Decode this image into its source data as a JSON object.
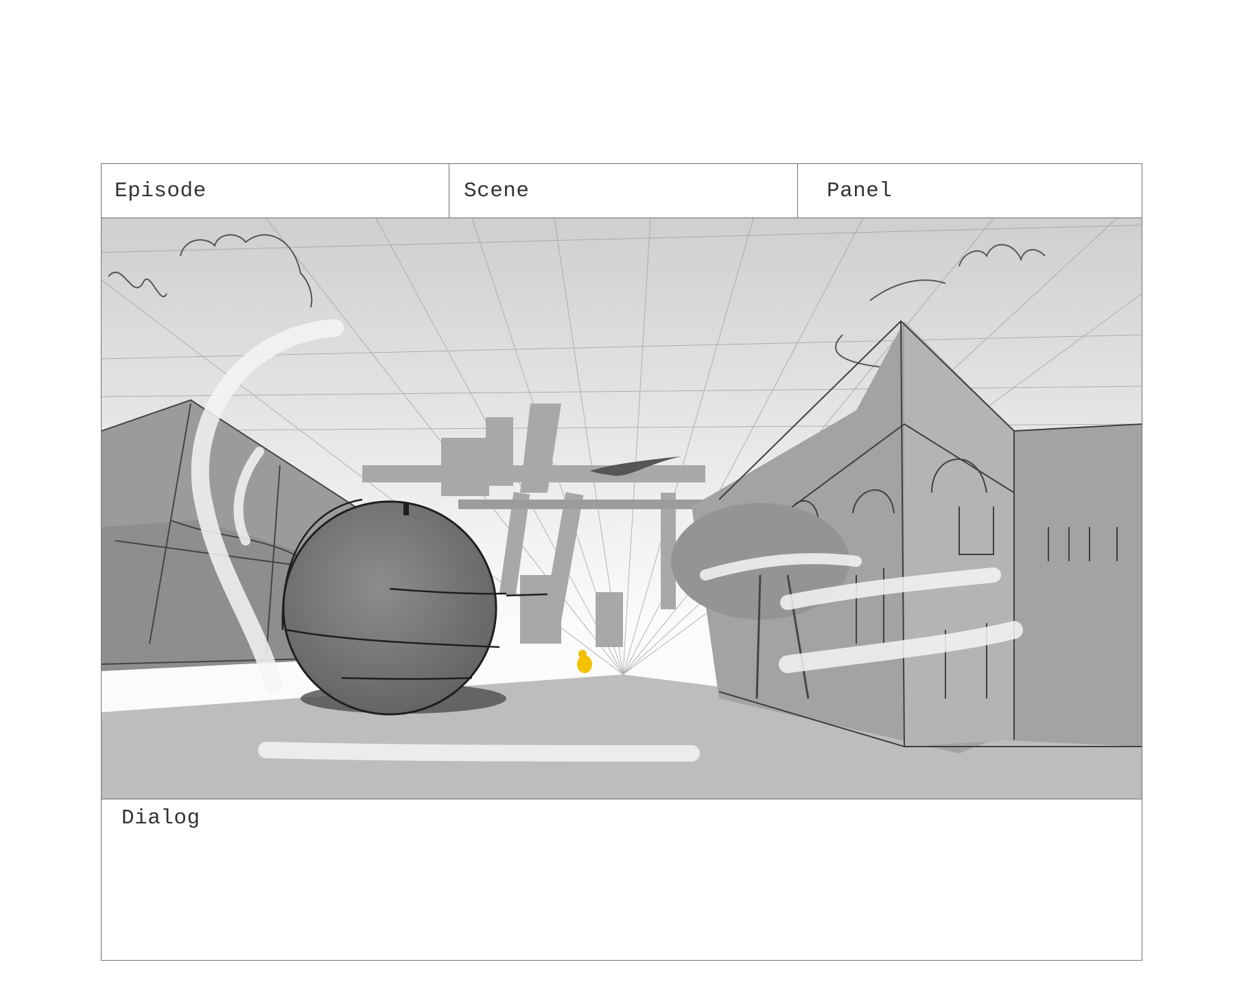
{
  "header": {
    "episode_label": "Episode",
    "scene_label": "Scene",
    "panel_label": "Panel"
  },
  "panel_art": {
    "accent_color": "#f2c200",
    "tone_colors": [
      "#6e6e6e",
      "#9a9a9a",
      "#c4c4c4",
      "#e4e4e4"
    ]
  },
  "dialog": {
    "label": "Dialog",
    "text": ""
  }
}
